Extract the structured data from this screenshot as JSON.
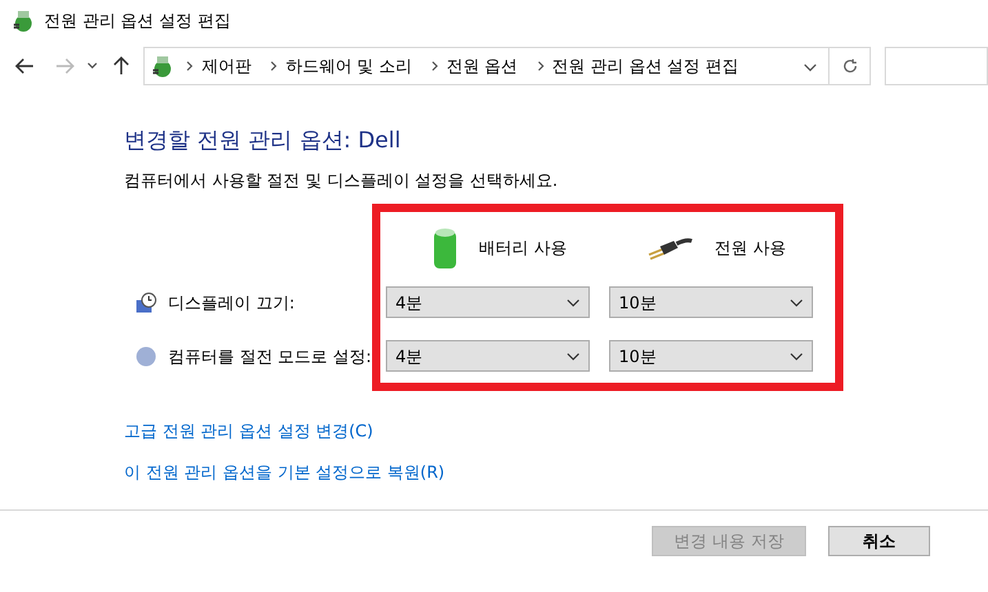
{
  "window": {
    "title": "전원 관리 옵션 설정 편집"
  },
  "nav": {
    "back_disabled": false,
    "forward_disabled": true
  },
  "breadcrumb": [
    "제어판",
    "하드웨어 및 소리",
    "전원 옵션",
    "전원 관리 옵션 설정 편집"
  ],
  "heading": "변경할 전원 관리 옵션: Dell",
  "subtitle": "컴퓨터에서 사용할 절전 및 디스플레이 설정을 선택하세요.",
  "columns": [
    {
      "kind": "battery",
      "label": "배터리 사용"
    },
    {
      "kind": "plug",
      "label": "전원 사용"
    }
  ],
  "settings": [
    {
      "kind": "display",
      "label": "디스플레이 끄기:",
      "values": [
        "4분",
        "10분"
      ]
    },
    {
      "kind": "sleep",
      "label": "컴퓨터를 절전 모드로 설정:",
      "values": [
        "4분",
        "10분"
      ]
    }
  ],
  "links": [
    "고급 전원 관리 옵션 설정 변경(C)",
    "이 전원 관리 옵션을 기본 설정으로 복원(R)"
  ],
  "buttons": [
    {
      "label": "변경 내용 저장",
      "disabled": true
    },
    {
      "label": "취소",
      "disabled": false
    }
  ]
}
